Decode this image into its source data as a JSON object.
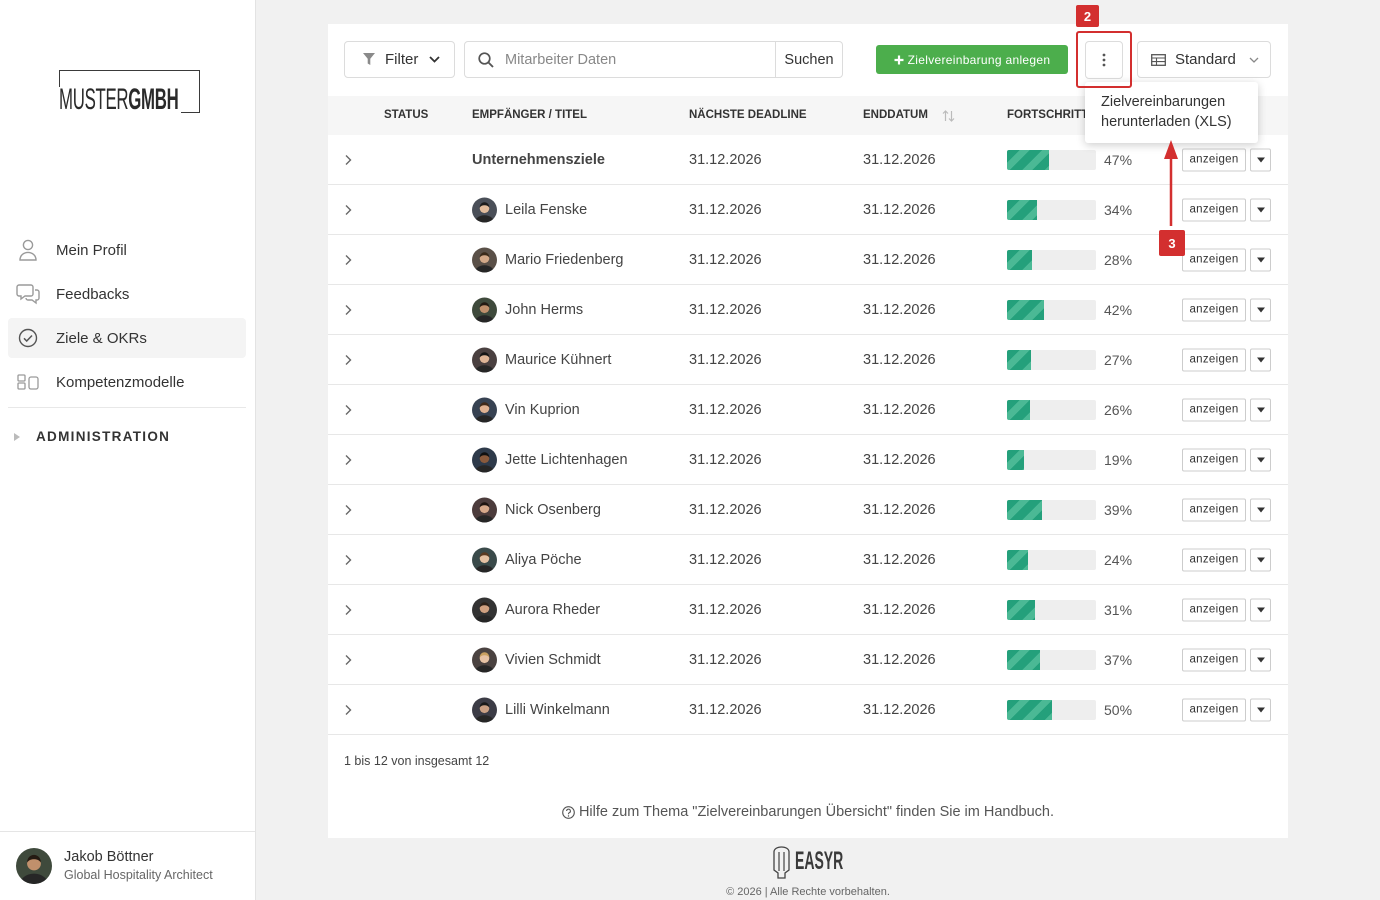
{
  "sidebar": {
    "logo": {
      "light": "MUSTER",
      "bold": "GMBH"
    },
    "nav": [
      {
        "label": "Mein Profil",
        "icon": "user-icon",
        "active": false
      },
      {
        "label": "Feedbacks",
        "icon": "chat-icon",
        "active": false
      },
      {
        "label": "Ziele & OKRs",
        "icon": "check-circle-icon",
        "active": true
      },
      {
        "label": "Kompetenzmodelle",
        "icon": "blocks-icon",
        "active": false
      }
    ],
    "admin": {
      "label": "ADMINISTRATION",
      "icon": "caret-right-icon"
    },
    "user": {
      "name": "Jakob Böttner",
      "role": "Global Hospitality Architect"
    }
  },
  "toolbar": {
    "filter": {
      "label": "Filter",
      "icon": "funnel-icon"
    },
    "search": {
      "placeholder": "Mitarbeiter Daten",
      "button_label": "Suchen",
      "icon": "search-icon"
    },
    "create_button": {
      "label": "Zielvereinbarung anlegen",
      "icon": "plus-icon"
    },
    "more_button": {
      "icon": "kebab-icon"
    },
    "view_select": {
      "label": "Standard",
      "icon": "table-icon"
    }
  },
  "more_menu": {
    "open": true,
    "items": [
      {
        "label": "Zielvereinbarungen herunterladen (XLS)"
      }
    ]
  },
  "annotations": {
    "step_2": "2",
    "step_3": "3"
  },
  "table": {
    "columns": {
      "status": "STATUS",
      "recipient": "EMPFÄNGER / TITEL",
      "deadline": "NÄCHSTE DEADLINE",
      "end_date": "ENDDATUM",
      "progress": "FORTSCHRITT"
    },
    "row_action_label": "anzeigen",
    "rows": [
      {
        "title": "Unternehmensziele",
        "has_avatar": false,
        "bold": true,
        "deadline": "31.12.2026",
        "end_date": "31.12.2026",
        "progress": "47%"
      },
      {
        "title": "Leila Fenske",
        "has_avatar": true,
        "bold": false,
        "deadline": "31.12.2026",
        "end_date": "31.12.2026",
        "progress": "34%"
      },
      {
        "title": "Mario Friedenberg",
        "has_avatar": true,
        "bold": false,
        "deadline": "31.12.2026",
        "end_date": "31.12.2026",
        "progress": "28%"
      },
      {
        "title": "John Herms",
        "has_avatar": true,
        "bold": false,
        "deadline": "31.12.2026",
        "end_date": "31.12.2026",
        "progress": "42%"
      },
      {
        "title": "Maurice Kühnert",
        "has_avatar": true,
        "bold": false,
        "deadline": "31.12.2026",
        "end_date": "31.12.2026",
        "progress": "27%"
      },
      {
        "title": "Vin Kuprion",
        "has_avatar": true,
        "bold": false,
        "deadline": "31.12.2026",
        "end_date": "31.12.2026",
        "progress": "26%"
      },
      {
        "title": "Jette Lichtenhagen",
        "has_avatar": true,
        "bold": false,
        "deadline": "31.12.2026",
        "end_date": "31.12.2026",
        "progress": "19%"
      },
      {
        "title": "Nick Osenberg",
        "has_avatar": true,
        "bold": false,
        "deadline": "31.12.2026",
        "end_date": "31.12.2026",
        "progress": "39%"
      },
      {
        "title": "Aliya Pöche",
        "has_avatar": true,
        "bold": false,
        "deadline": "31.12.2026",
        "end_date": "31.12.2026",
        "progress": "24%"
      },
      {
        "title": "Aurora Rheder",
        "has_avatar": true,
        "bold": false,
        "deadline": "31.12.2026",
        "end_date": "31.12.2026",
        "progress": "31%"
      },
      {
        "title": "Vivien Schmidt",
        "has_avatar": true,
        "bold": false,
        "deadline": "31.12.2026",
        "end_date": "31.12.2026",
        "progress": "37%"
      },
      {
        "title": "Lilli Winkelmann",
        "has_avatar": true,
        "bold": false,
        "deadline": "31.12.2026",
        "end_date": "31.12.2026",
        "progress": "50%"
      }
    ]
  },
  "pagination": {
    "summary": "1 bis 12 von insgesamt 12"
  },
  "help": {
    "text": "Hilfe zum Thema \"Zielvereinbarungen Übersicht\" finden Sie im Handbuch.",
    "icon": "help-circle-icon"
  },
  "footer": {
    "brand": "EASYR",
    "copyright": "© 2026 | Alle Rechte vorbehalten."
  },
  "colors": {
    "accent_green": "#4cae4c",
    "progress_fill": "#24a07b",
    "annotation_red": "#d32f2f",
    "active_nav_bg": "#f4f4f4"
  }
}
